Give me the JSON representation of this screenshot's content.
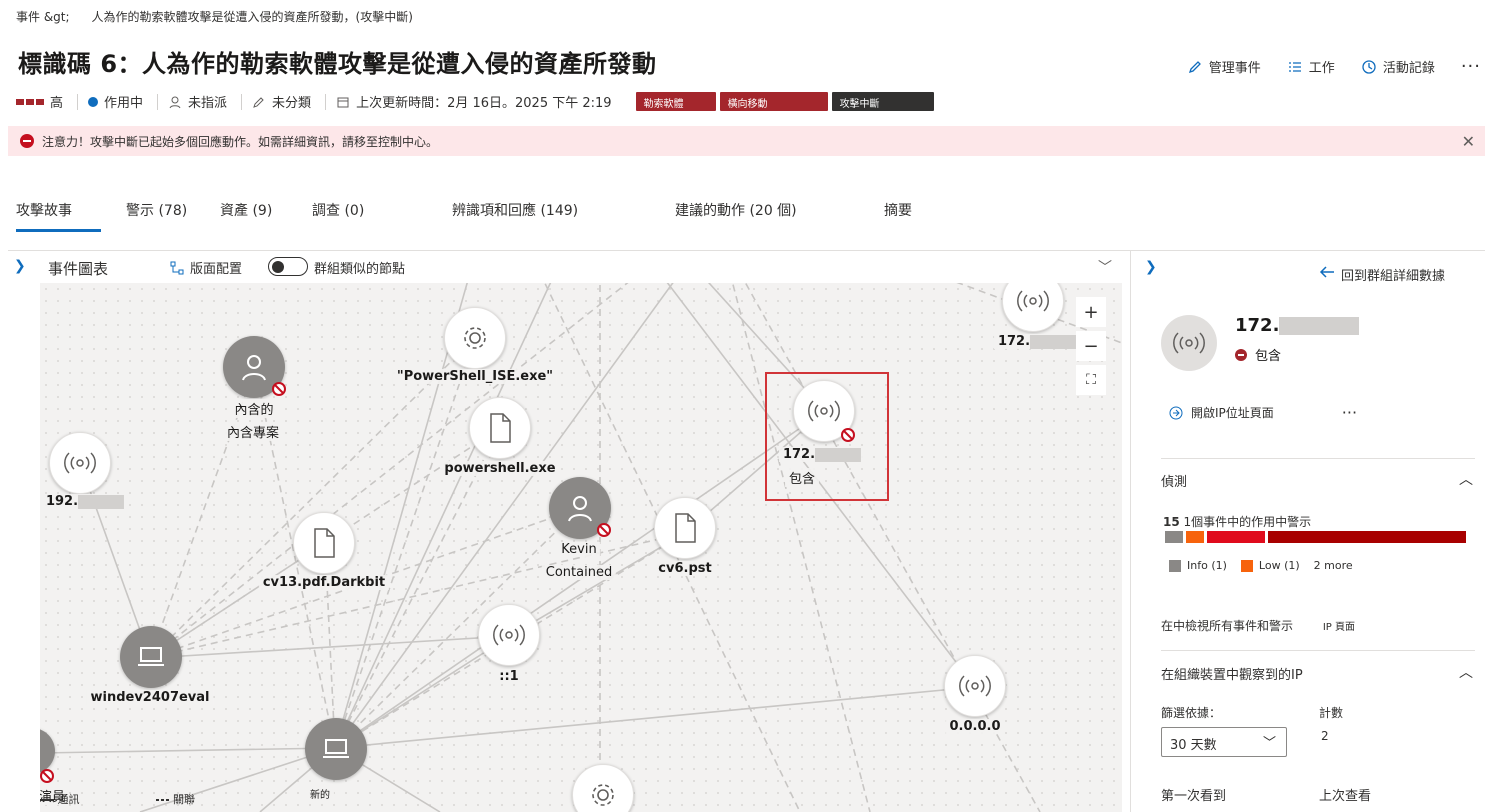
{
  "breadcrumb": {
    "root": "事件 &gt;",
    "current": "人為作的勒索軟體攻擊是從遭入侵的資產所發動，(攻擊中斷)"
  },
  "title": "標識碼 6：人為作的勒索軟體攻擊是從遭入侵的資產所發動",
  "actions": {
    "manage": "管理事件",
    "tasks": "工作",
    "activity": "活動記錄",
    "more": "···"
  },
  "meta": {
    "severity": "高",
    "status": "作用中",
    "assigned": "未指派",
    "classification": "未分類",
    "updated": "上次更新時間：2月 16日。2025 下午 2:19"
  },
  "tags": [
    "勒索軟體",
    "橫向移動",
    "攻擊中斷"
  ],
  "banner": {
    "text": "注意力！攻擊中斷已起始多個回應動作。如需詳細資訊，請移至控制中心。"
  },
  "tabs": [
    "攻擊故事",
    "警示 (78)",
    "資產 (9)",
    "調查 (0)",
    "辨識項和回應 (149)",
    "建議的動作 (20 個)",
    "摘要"
  ],
  "graph": {
    "title": "事件圖表",
    "layout_label": "版面配置",
    "group_label": "群組類似的節點",
    "nodes": {
      "ip_top": "172.",
      "user1_line1": "內含的",
      "user1_line2": "內含專案",
      "ps_ise": "\"PowerShell_ISE.exe\"",
      "powershell": "powershell.exe",
      "ip_sel": "172.",
      "ip_sel_status": "包含",
      "ip_left": "192.",
      "kevin_line1": "Kevin",
      "kevin_line2": "Contained",
      "cv6": "cv6.pst",
      "cv13": "cv13.pdf.Darkbit",
      "ipv6": "::1",
      "windev": "windev2407eval",
      "zero": "0.0.0.0",
      "newdev": "新的",
      "actor": "演員"
    },
    "legend": {
      "comm": "通訊",
      "assoc": "關聯"
    }
  },
  "panel": {
    "back": "回到群組詳細數據",
    "ip": "172.",
    "status": "包含",
    "open_ip": "開啟IP位址頁面",
    "more": "···",
    "detect_title": "偵測",
    "alert_count": "15",
    "alert_text": "1個事件中的作用中警示",
    "legend_info": "Info (1)",
    "legend_low": "Low (1)",
    "legend_more": "2 more",
    "view_all": "在中檢視所有事件和警示",
    "ip_page": "IP 頁面",
    "observed_title": "在組織裝置中觀察到的IP",
    "filter_label": "篩選依據：",
    "filter_value": "30 天數",
    "count_label": "計數",
    "count_value": "2",
    "first_seen": "第一次看到",
    "last_seen": "上次查看"
  },
  "colors": {
    "accent": "#0f6cbd",
    "danger": "#a4262c",
    "highlight": "#d13438",
    "info": "#8a8886",
    "low": "#f7630c",
    "medium": "#e00b1c",
    "high": "#a80000"
  }
}
